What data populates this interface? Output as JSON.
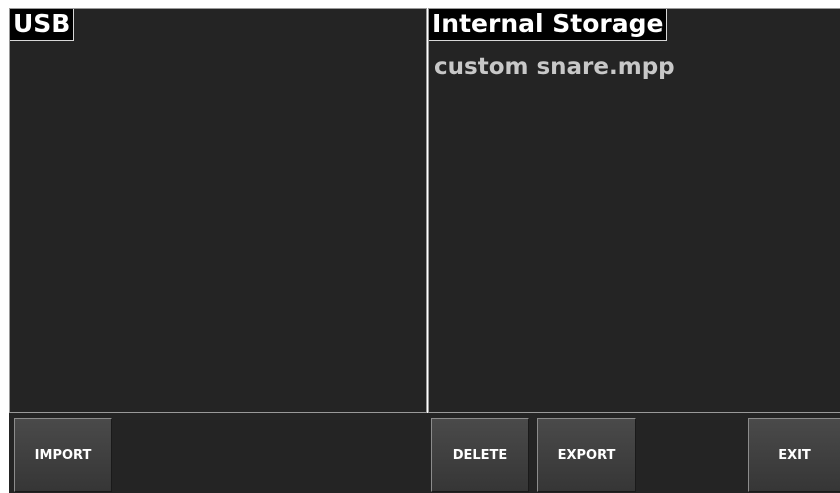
{
  "usb_panel": {
    "title": "USB",
    "files": []
  },
  "internal_panel": {
    "title": "Internal Storage",
    "files": [
      "custom snare.mpp"
    ]
  },
  "buttons": {
    "import": "IMPORT",
    "delete": "DELETE",
    "export": "EXPORT",
    "exit": "EXIT"
  },
  "colors": {
    "panel_background": "#242424",
    "title_background": "#000000",
    "file_text": "#c8c8c8",
    "button_text": "#ffffff"
  }
}
